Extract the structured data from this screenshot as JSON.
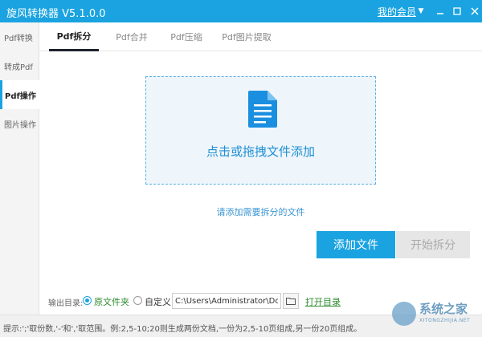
{
  "app": {
    "title": "旋风转换器 V5.1.0.0",
    "vip_label": "我的会员",
    "accent_color": "#1aa3e0"
  },
  "window_controls": {
    "dropdown_icon": "chevron-down-icon",
    "minimize_icon": "minimize-icon",
    "maximize_icon": "maximize-icon",
    "close_icon": "close-icon"
  },
  "sidebar": {
    "items": [
      {
        "label": "Pdf转换",
        "active": false
      },
      {
        "label": "转成Pdf",
        "active": false
      },
      {
        "label": "Pdf操作",
        "active": true
      },
      {
        "label": "图片操作",
        "active": false
      }
    ]
  },
  "tabs": [
    {
      "label": "Pdf拆分",
      "active": true
    },
    {
      "label": "Pdf合并",
      "active": false
    },
    {
      "label": "Pdf压缩",
      "active": false
    },
    {
      "label": "Pdf图片提取",
      "active": false
    }
  ],
  "dropzone": {
    "icon": "document-icon",
    "text": "点击或拖拽文件添加"
  },
  "hint": "请添加需要拆分的文件",
  "actions": {
    "add_file": "添加文件",
    "start_split": "开始拆分"
  },
  "output": {
    "label": "输出目录:",
    "option_original": "原文件夹",
    "option_custom": "自定义",
    "selected": "原文件夹",
    "path_value": "C:\\Users\\Administrator\\Documents",
    "open_dir": "打开目录"
  },
  "tip": "提示:';'取份数,'-'和','取范围。例:2,5-10;20则生成两份文档,一份为2,5-10页组成,另一份20页组成。",
  "watermark": {
    "title": "系统之家",
    "subtitle": "XITONGZHIJIA.NET"
  }
}
